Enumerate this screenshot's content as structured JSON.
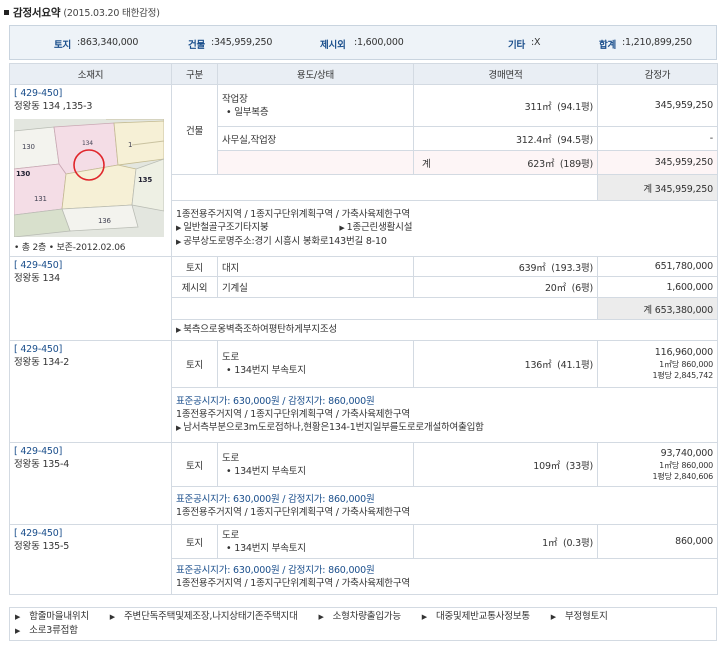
{
  "header": {
    "title": "감정서요약",
    "sub": "(2015.03.20 태한감정)"
  },
  "summary": {
    "land_label": "토지",
    "land_value": ":863,340,000",
    "building_label": "건물",
    "building_value": ":345,959,250",
    "excluded_label": "제시외",
    "excluded_value": ":1,600,000",
    "other_label": "기타",
    "other_value": ":X",
    "total_label": "합계",
    "total_value": ":1,210,899,250"
  },
  "columns": [
    "소재지",
    "구분",
    "용도/상태",
    "경매면적",
    "감정가"
  ],
  "map_labels": [
    "130",
    "134",
    "1",
    "130",
    "135",
    "131",
    "136"
  ],
  "rows": [
    {
      "case": "[ 429-450]",
      "address": "정왕동 134 ,135-3",
      "meta": "• 총 2층  • 보존-2012.02.06",
      "kind": "건물",
      "items": [
        {
          "use": "작업장",
          "use2": "• 일부복층",
          "area": "311㎡",
          "pyeong": "(94.1평)",
          "price": "345,959,250"
        },
        {
          "use": "사무실,작업장",
          "area": "312.4㎡",
          "pyeong": "(94.5평)",
          "price": "-"
        },
        {
          "use": "계",
          "area": "623㎡",
          "pyeong": "(189평)",
          "price": "345,959,250"
        }
      ],
      "subtotal": "계 345,959,250",
      "notes": [
        "1종전용주거지역 / 1종지구단위계획구역 / 가축사육제한구역",
        "일반철골구조기타지붕",
        "1종근린생활시설",
        "공부상도로명주소:경기 시흥시 봉화로143번길 8-10"
      ]
    },
    {
      "case": "[ 429-450]",
      "address": "정왕동 134",
      "items": [
        {
          "kind": "토지",
          "use": "대지",
          "area": "639㎡",
          "pyeong": "(193.3평)",
          "price": "651,780,000"
        },
        {
          "kind": "제시외",
          "use": "기계실",
          "area": "20㎡",
          "pyeong": "(6평)",
          "price": "1,600,000"
        }
      ],
      "subtotal": "계 653,380,000",
      "notes": [
        "북측으로옹벽축조하여평탄하게부지조성"
      ]
    },
    {
      "case": "[ 429-450]",
      "address": "정왕동 134-2",
      "kind": "토지",
      "use": "도로",
      "use2": "• 134번지 부속토지",
      "area": "136㎡",
      "pyeong": "(41.1평)",
      "price": "116,960,000",
      "price_m2": "1㎡당 860,000",
      "price_py": "1평당 2,845,742",
      "notes_blue": "표준공시지가: 630,000원 / 감정지가: 860,000원",
      "notes": [
        "1종전용주거지역 / 1종지구단위계획구역 / 가축사육제한구역",
        "남서측부분으로3m도로접하나,현황은134-1번지일부를도로로개설하여출입함"
      ]
    },
    {
      "case": "[ 429-450]",
      "address": "정왕동 135-4",
      "kind": "토지",
      "use": "도로",
      "use2": "• 134번지 부속토지",
      "area": "109㎡",
      "pyeong": "(33평)",
      "price": "93,740,000",
      "price_m2": "1㎡당 860,000",
      "price_py": "1평당 2,840,606",
      "notes_blue": "표준공시지가: 630,000원 / 감정지가: 860,000원",
      "notes": [
        "1종전용주거지역 / 1종지구단위계획구역 / 가축사육제한구역"
      ]
    },
    {
      "case": "[ 429-450]",
      "address": "정왕동 135-5",
      "kind": "토지",
      "use": "도로",
      "use2": "• 134번지 부속토지",
      "area": "1㎡",
      "pyeong": "(0.3평)",
      "price": "860,000",
      "notes_blue": "표준공시지가: 630,000원 / 감정지가: 860,000원",
      "notes": [
        "1종전용주거지역 / 1종지구단위계획구역 / 가축사육제한구역"
      ]
    }
  ],
  "footer": [
    "함줄마을내위치",
    "주변단독주택및제조장,나지상태기존주택지대",
    "소형차량출입가능",
    "대중및제반교통사정보통",
    "부정형토지",
    "소로3류접함"
  ]
}
